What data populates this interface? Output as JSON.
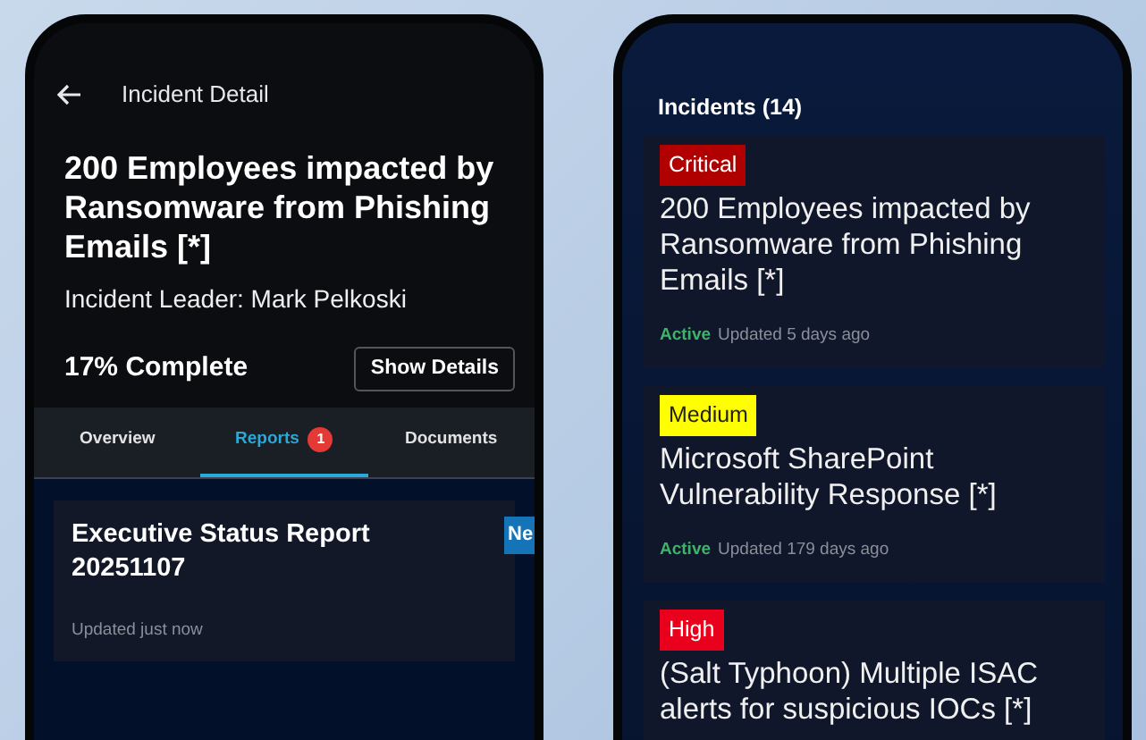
{
  "detail_screen": {
    "title": "Incident Detail",
    "incident_title": "200 Employees impacted by Ransomware from Phishing Emails [*]",
    "leader": "Incident Leader: Mark Pelkoski",
    "progress": "17% Complete",
    "details_button": "Show Details",
    "tabs": [
      {
        "label": "Overview",
        "selected": false
      },
      {
        "label": "Reports",
        "selected": true,
        "count": "1"
      },
      {
        "label": "Documents",
        "selected": false
      }
    ],
    "reports": [
      {
        "title": "Executive Status Report 20251107",
        "updated": "Updated just now",
        "badge": "Ne"
      }
    ]
  },
  "list_screen": {
    "heading": "Incidents (14)",
    "incidents": [
      {
        "severity": "Critical",
        "color": "#b00000",
        "title": "200 Employees impacted by Ransomware from Phishing Emails [*]",
        "status": "Active",
        "updated": "Updated 5 days ago"
      },
      {
        "severity": "Medium",
        "color": "#ffff00",
        "title": "Microsoft SharePoint Vulnerability Response [*]",
        "status": "Active",
        "updated": "Updated 179 days ago"
      },
      {
        "severity": "High",
        "color": "#e8001c",
        "title": "(Salt Typhoon) Multiple ISAC alerts for suspicious IOCs [*]"
      }
    ]
  }
}
